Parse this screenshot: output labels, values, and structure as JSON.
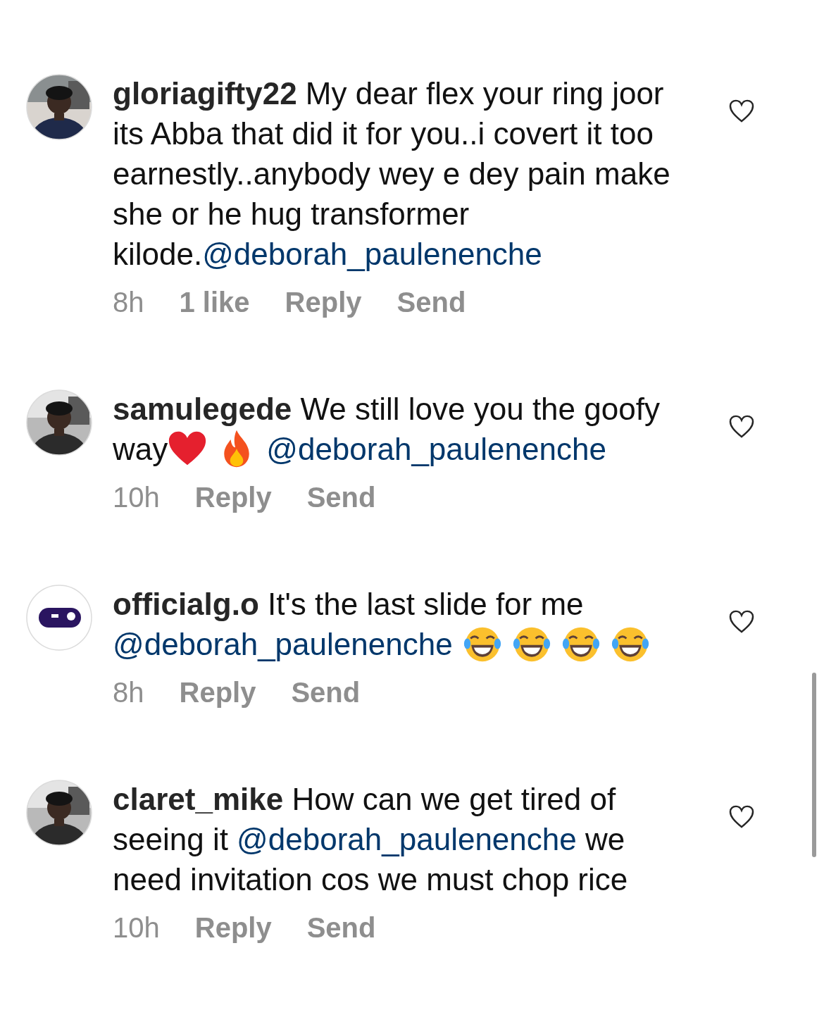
{
  "comments": [
    {
      "username": "gloriagifty22",
      "avatar": {
        "kind": "picture"
      },
      "liked": false,
      "body": [
        {
          "kind": "text",
          "text": "My dear flex your ring joor its Abba that did it for you..i covert it too earnestly..anybody wey e dey pain make she or he hug transformer kilode."
        },
        {
          "kind": "mention",
          "text": "@deborah_paulenenche"
        }
      ],
      "time": "8h",
      "likes": "1 like",
      "actions": [
        "Reply",
        "Send"
      ]
    },
    {
      "username": "samulegede",
      "avatar": {
        "kind": "picture"
      },
      "liked": false,
      "body": [
        {
          "kind": "text",
          "text": "We still love you the goofy way"
        },
        {
          "kind": "heart"
        },
        {
          "kind": "fire"
        },
        {
          "kind": "mention",
          "text": "@deborah_paulenenche"
        }
      ],
      "time": "10h",
      "actions": [
        "Reply",
        "Send"
      ]
    },
    {
      "username": "officialg.o",
      "avatar": {
        "kind": "logo"
      },
      "liked": false,
      "body": [
        {
          "kind": "text",
          "text": "It's the last slide for me "
        },
        {
          "kind": "mention",
          "text": "@deborah_paulenenche"
        },
        {
          "kind": "laugh"
        },
        {
          "kind": "laugh"
        },
        {
          "kind": "laugh"
        },
        {
          "kind": "laugh"
        }
      ],
      "time": "8h",
      "actions": [
        "Reply",
        "Send"
      ]
    },
    {
      "username": "claret_mike",
      "avatar": {
        "kind": "picture"
      },
      "liked": false,
      "body": [
        {
          "kind": "text",
          "text": "How can we get tired of seeing it "
        },
        {
          "kind": "mention",
          "text": "@deborah_paulenenche"
        },
        {
          "kind": "text",
          "text": " we need invitation cos we must chop rice"
        }
      ],
      "time": "10h",
      "actions": [
        "Reply",
        "Send"
      ]
    }
  ]
}
